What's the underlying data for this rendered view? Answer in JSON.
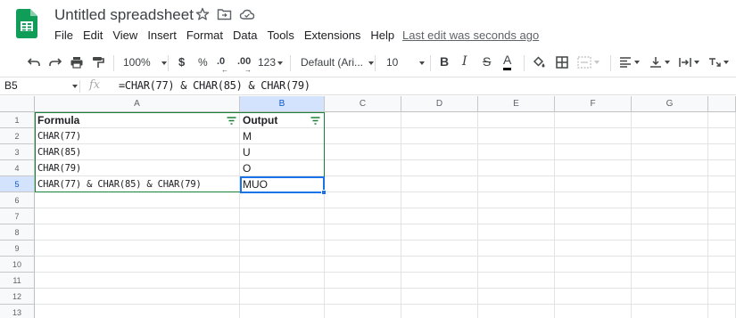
{
  "doc": {
    "title": "Untitled spreadsheet"
  },
  "menu": {
    "items": [
      "File",
      "Edit",
      "View",
      "Insert",
      "Format",
      "Data",
      "Tools",
      "Extensions",
      "Help"
    ],
    "last_edit": "Last edit was seconds ago"
  },
  "toolbar": {
    "zoom": "100%",
    "currency": "$",
    "percent": "%",
    "decrease_decimal": ".0",
    "increase_decimal": ".00",
    "more_formats": "123",
    "font": "Default (Ari...",
    "font_size": "10",
    "bold": "B",
    "italic": "I",
    "strike": "S",
    "text_color": "A"
  },
  "formula_bar": {
    "name_box": "B5",
    "fx": "fx",
    "formula": "=CHAR(77) & CHAR(85) & CHAR(79)"
  },
  "sheet": {
    "columns": [
      "A",
      "B",
      "C",
      "D",
      "E",
      "F",
      "G"
    ],
    "rows": [
      "1",
      "2",
      "3",
      "4",
      "5",
      "6",
      "7",
      "8",
      "9",
      "10",
      "11",
      "12",
      "13"
    ],
    "headers": {
      "a": "Formula",
      "b": "Output"
    },
    "data": [
      {
        "formula": "CHAR(77)",
        "output": "M"
      },
      {
        "formula": "CHAR(85)",
        "output": "U"
      },
      {
        "formula": "CHAR(79)",
        "output": "O"
      },
      {
        "formula": "CHAR(77) & CHAR(85) & CHAR(79)",
        "output": "MUO"
      }
    ],
    "selected_cell": "B5"
  },
  "colors": {
    "brand": "#0f9d58",
    "selection": "#1a73e8",
    "filter_range": "#188038",
    "header_selected": "#d3e3fd"
  }
}
